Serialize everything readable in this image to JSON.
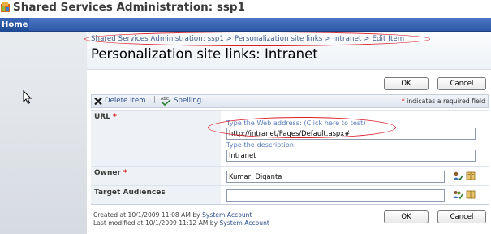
{
  "header": {
    "site_title": "Shared Services Administration: ssp1",
    "home_tab": "Home"
  },
  "breadcrumb": {
    "items": [
      "Shared Services Administration: ssp1",
      "Personalization site links",
      "Intranet",
      "Edit Item"
    ],
    "separator": ">"
  },
  "page": {
    "title": "Personalization site links: Intranet"
  },
  "buttons": {
    "ok": "OK",
    "cancel": "Cancel"
  },
  "toolbar": {
    "delete_label": "Delete Item",
    "separator": "|",
    "spelling_label": "Spelling...",
    "required_star": "*",
    "required_note": "indicates a required field"
  },
  "form": {
    "url": {
      "label": "URL",
      "required": "*",
      "address_hint_prefix": "Type the Web address: (",
      "address_hint_link": "Click here to test",
      "address_hint_suffix": ")",
      "address_value": "http://intranet/Pages/Default.aspx#",
      "description_hint": "Type the description:",
      "description_value": "Intranet"
    },
    "owner": {
      "label": "Owner",
      "required": "*",
      "value": "Kumar, Diganta"
    },
    "target_audiences": {
      "label": "Target Audiences",
      "value": ""
    }
  },
  "footer": {
    "created_prefix": "Created at 10/1/2009 11:08 AM  by ",
    "created_by": "System Account",
    "modified_prefix": "Last modified at 10/1/2009 11:12 AM  by ",
    "modified_by": "System Account"
  },
  "colors": {
    "annotation_oval": "#d8202c",
    "nav_bar": "#2d5aa8",
    "link": "#2b4f8d"
  },
  "icons": [
    "site-logo-icon",
    "mouse-cursor-icon",
    "delete-x-icon",
    "spelling-icon",
    "check-names-icon",
    "browse-directory-icon"
  ]
}
